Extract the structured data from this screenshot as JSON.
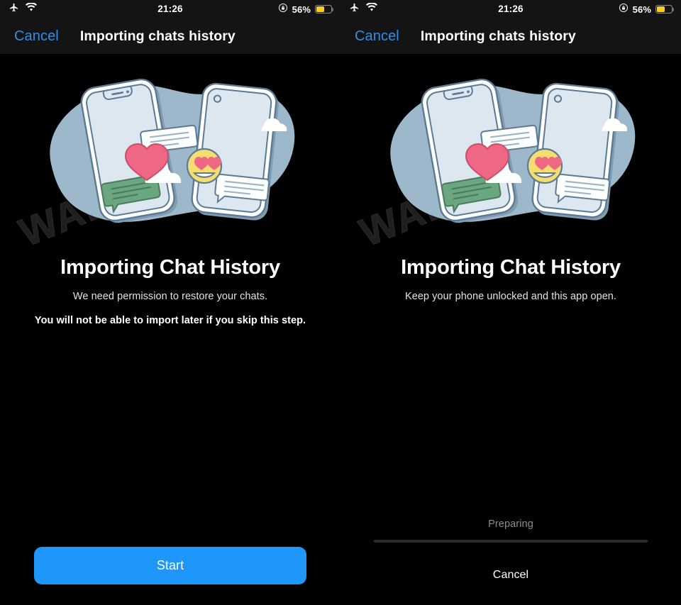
{
  "panels": [
    {
      "status_bar": {
        "airplane_icon": "airplane-mode-icon",
        "wifi_icon": "wifi-icon",
        "time": "21:26",
        "rotation_lock_icon": "rotation-lock-icon",
        "battery_percent": "56%",
        "battery_level": 56,
        "battery_color": "#f5cf24"
      },
      "nav": {
        "cancel_label": "Cancel",
        "title": "Importing chats history",
        "cancel_color": "#2f8fe8"
      },
      "watermark": "WABETAINFO",
      "headline": "Importing Chat History",
      "subtitle": "We need permission to restore your chats.",
      "warning": "You will not be able to import later if you skip this step.",
      "primary_button": {
        "label": "Start",
        "color": "#1e96fa"
      },
      "progress": null
    },
    {
      "status_bar": {
        "airplane_icon": "airplane-mode-icon",
        "wifi_icon": "wifi-icon",
        "time": "21:26",
        "rotation_lock_icon": "rotation-lock-icon",
        "battery_percent": "56%",
        "battery_level": 56,
        "battery_color": "#f5cf24"
      },
      "nav": {
        "cancel_label": "Cancel",
        "title": "Importing chats history",
        "cancel_color": "#2f8fe8"
      },
      "watermark": "WABETAINFO",
      "headline": "Importing Chat History",
      "subtitle": "Keep your phone unlocked and this app open.",
      "warning": "",
      "primary_button": null,
      "progress": {
        "status_label": "Preparing",
        "percent": 0,
        "cancel_label": "Cancel"
      }
    }
  ],
  "illustration": {
    "name": "two-phones-chat-transfer-illustration",
    "blob_color": "#9db8ca",
    "phone_body_color": "#ffffff",
    "phone_screen_color": "#dde7f0",
    "outline_color": "#5b7b95",
    "heart_color": "#ee6886",
    "emoji_color": "#f5dd72",
    "green_bubble_color": "#6aa67f",
    "cloud_color": "#ffffff"
  }
}
